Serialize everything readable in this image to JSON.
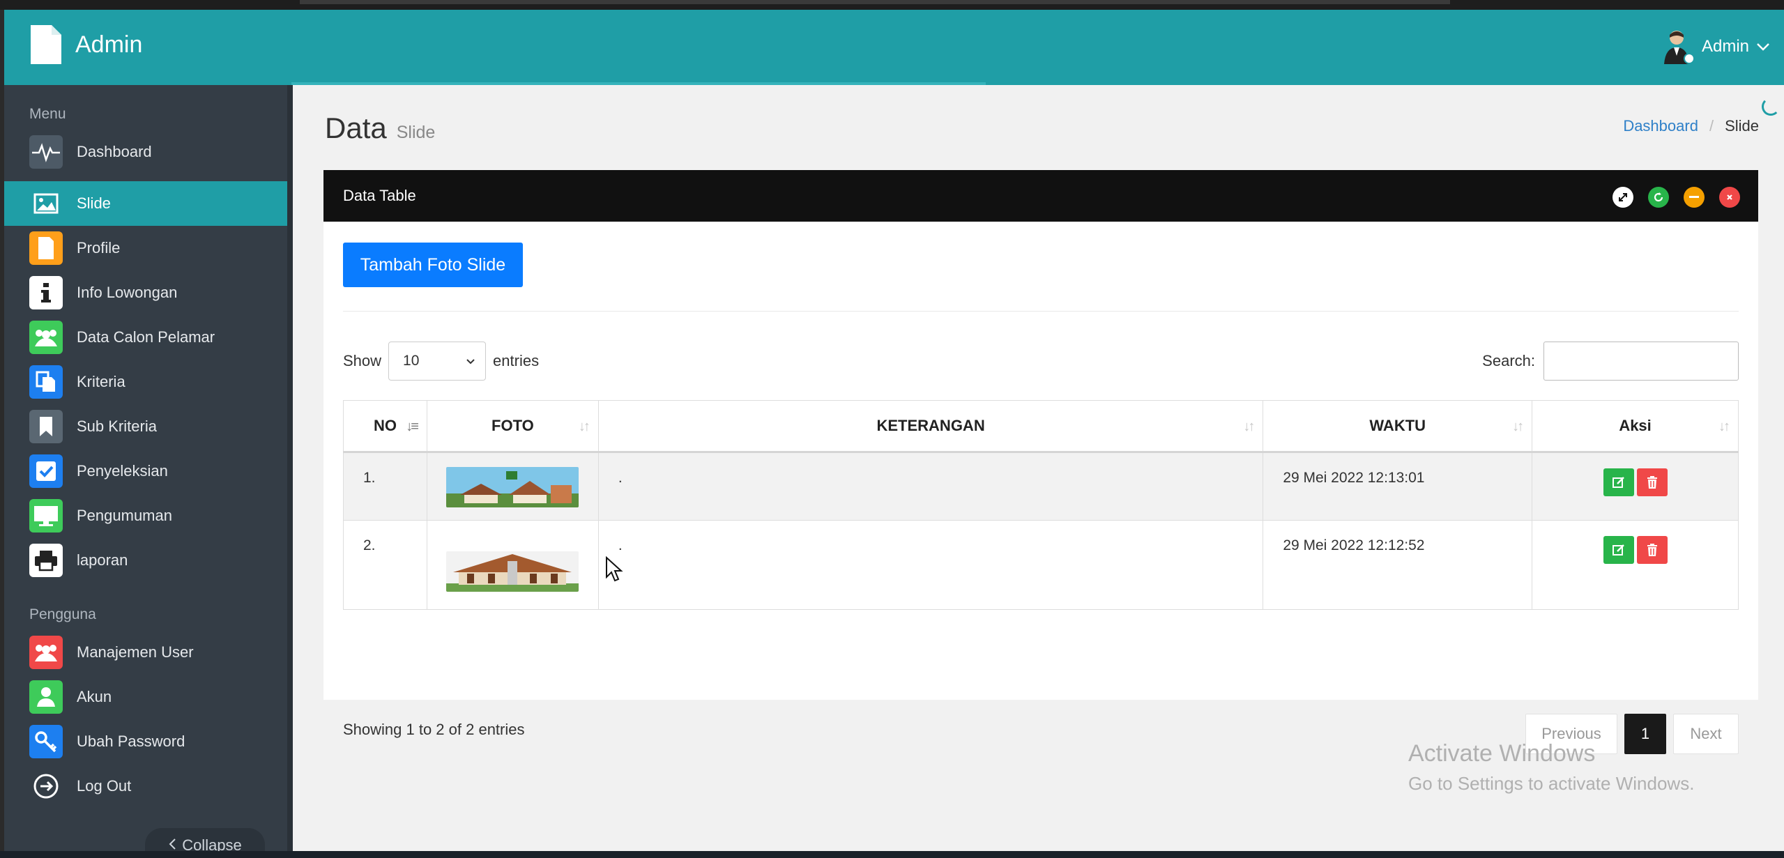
{
  "header": {
    "app_title": "Admin",
    "user_name": "Admin"
  },
  "sidebar": {
    "menu_label": "Menu",
    "items": [
      {
        "label": "Dashboard",
        "icon": "pulse-icon",
        "color": "#4d5a66"
      },
      {
        "label": "Slide",
        "icon": "image-icon",
        "color": "#1f9ea6"
      },
      {
        "label": "Profile",
        "icon": "document-icon",
        "color": "#ff9f1a"
      },
      {
        "label": "Info Lowongan",
        "icon": "info-icon",
        "color": "#ffffff"
      },
      {
        "label": "Data Calon Pelamar",
        "icon": "users-icon",
        "color": "#3ecb5a"
      },
      {
        "label": "Kriteria",
        "icon": "copy-icon",
        "color": "#1d7ff0"
      },
      {
        "label": "Sub Kriteria",
        "icon": "bookmark-icon",
        "color": "#5a6772"
      },
      {
        "label": "Penyeleksian",
        "icon": "checkbox-icon",
        "color": "#1d7ff0"
      },
      {
        "label": "Pengumuman",
        "icon": "monitor-icon",
        "color": "#3ecb5a"
      },
      {
        "label": "laporan",
        "icon": "printer-icon",
        "color": "#ffffff"
      }
    ],
    "pengguna_label": "Pengguna",
    "user_items": [
      {
        "label": "Manajemen User",
        "icon": "users-icon",
        "color": "#f04848"
      },
      {
        "label": "Akun",
        "icon": "user-icon",
        "color": "#3ecb5a"
      },
      {
        "label": "Ubah Password",
        "icon": "key-icon",
        "color": "#1d7ff0"
      },
      {
        "label": "Log Out",
        "icon": "logout-icon",
        "color": "#343d46"
      }
    ],
    "collapse_label": "Collapse"
  },
  "page": {
    "title": "Data",
    "subtitle": "Slide"
  },
  "breadcrumb": {
    "home": "Dashboard",
    "sep": "/",
    "current": "Slide"
  },
  "panel": {
    "title": "Data Table"
  },
  "toolbar": {
    "add_label": "Tambah Foto Slide"
  },
  "datatable": {
    "show_label": "Show",
    "entries_value": "10",
    "entries_label": "entries",
    "search_label": "Search:",
    "columns": [
      "NO",
      "FOTO",
      "KETERANGAN",
      "WAKTU",
      "Aksi"
    ],
    "rows": [
      {
        "no": "1.",
        "keterangan": ".",
        "waktu": "29 Mei 2022 12:13:01"
      },
      {
        "no": "2.",
        "keterangan": ".",
        "waktu": "29 Mei 2022 12:12:52"
      }
    ],
    "info": "Showing 1 to 2 of 2 entries",
    "pager": {
      "prev": "Previous",
      "page": "1",
      "next": "Next"
    }
  },
  "watermark": {
    "line1": "Activate Windows",
    "line2": "Go to Settings to activate Windows."
  }
}
